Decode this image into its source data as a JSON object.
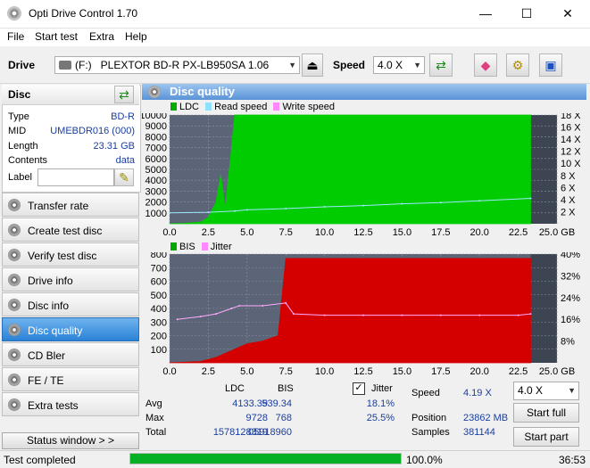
{
  "window": {
    "title": "Opti Drive Control 1.70",
    "minimize": "—",
    "maximize": "☐",
    "close": "✕"
  },
  "menu": [
    "File",
    "Start test",
    "Extra",
    "Help"
  ],
  "toolbar": {
    "drive_label": "Drive",
    "drive_letter": "(F:)",
    "drive_name": "PLEXTOR BD-R  PX-LB950SA 1.06",
    "speed_label": "Speed",
    "speed_value": "4.0 X"
  },
  "disc": {
    "header": "Disc",
    "fields": [
      {
        "key": "Type",
        "value": "BD-R"
      },
      {
        "key": "MID",
        "value": "UMEBDR016 (000)"
      },
      {
        "key": "Length",
        "value": "23.31 GB"
      },
      {
        "key": "Contents",
        "value": "data"
      },
      {
        "key": "Label",
        "value": ""
      }
    ]
  },
  "nav": [
    "Transfer rate",
    "Create test disc",
    "Verify test disc",
    "Drive info",
    "Disc info",
    "Disc quality",
    "CD Bler",
    "FE / TE",
    "Extra tests"
  ],
  "nav_active": "Disc quality",
  "status_window_button": "Status window > >",
  "panel_title": "Disc quality",
  "chart_data": [
    {
      "type": "area",
      "legend": [
        "LDC",
        "Read speed",
        "Write speed"
      ],
      "colors": {
        "LDC": "#00cc00",
        "Read speed": "#90e0ff",
        "Write speed": "#ff88ff"
      },
      "x_ticks": [
        "0.0",
        "2.5",
        "5.0",
        "7.5",
        "10.0",
        "12.5",
        "15.0",
        "17.5",
        "20.0",
        "22.5",
        "25.0 GB"
      ],
      "y_left_ticks": [
        "10000",
        "9000",
        "8000",
        "7000",
        "6000",
        "5000",
        "4000",
        "3000",
        "2000",
        "1000"
      ],
      "y_right_ticks": [
        "18 X",
        "16 X",
        "14 X",
        "12 X",
        "10 X",
        "8 X",
        "6 X",
        "4 X",
        "2 X"
      ],
      "xlim": [
        0,
        25
      ],
      "ylim": [
        0,
        10000
      ],
      "y2lim": [
        0,
        18
      ],
      "series": [
        {
          "name": "LDC",
          "x": [
            0,
            1,
            2,
            2.5,
            3,
            3.3,
            3.6,
            4.0,
            4.2,
            23.3
          ],
          "y": [
            0,
            50,
            150,
            600,
            2000,
            4500,
            1500,
            7000,
            10000,
            10000
          ]
        },
        {
          "name": "Read speed",
          "x": [
            0,
            2.5,
            4.2,
            5,
            7.5,
            10,
            12.5,
            15,
            17.5,
            20,
            23.3
          ],
          "y": [
            1.8,
            1.9,
            2.1,
            2.3,
            2.5,
            2.8,
            3.0,
            3.3,
            3.5,
            3.8,
            4.2
          ]
        }
      ]
    },
    {
      "type": "area",
      "legend": [
        "BIS",
        "Jitter"
      ],
      "colors": {
        "BIS": "#dd0000",
        "Jitter": "#ff88ff"
      },
      "x_ticks": [
        "0.0",
        "2.5",
        "5.0",
        "7.5",
        "10.0",
        "12.5",
        "15.0",
        "17.5",
        "20.0",
        "22.5",
        "25.0 GB"
      ],
      "y_left_ticks": [
        "800",
        "700",
        "600",
        "500",
        "400",
        "300",
        "200",
        "100"
      ],
      "y_right_ticks": [
        "40%",
        "32%",
        "24%",
        "16%",
        "8%"
      ],
      "xlim": [
        0,
        25
      ],
      "ylim": [
        0,
        800
      ],
      "y2lim": [
        0,
        40
      ],
      "series": [
        {
          "name": "BIS",
          "x": [
            0,
            2,
            3,
            4,
            5,
            6,
            7,
            7.5,
            23.3
          ],
          "y": [
            0,
            10,
            40,
            90,
            140,
            160,
            200,
            768,
            768
          ]
        },
        {
          "name": "Jitter",
          "x": [
            0.5,
            2,
            3,
            4,
            4.5,
            6,
            7.5,
            8,
            10,
            12.5,
            15,
            17.5,
            20,
            22.5,
            23.3
          ],
          "y": [
            16,
            17,
            18,
            20,
            21,
            21,
            22,
            18,
            17.5,
            17.5,
            17.5,
            17.5,
            17.5,
            17.5,
            18
          ]
        }
      ]
    }
  ],
  "stats": {
    "col_ldc": "LDC",
    "col_bis": "BIS",
    "jitter_label": "Jitter",
    "jitter_checked": true,
    "rows": [
      {
        "label": "Avg",
        "ldc": "4133.39",
        "bis": "539.34",
        "jitter": "18.1%"
      },
      {
        "label": "Max",
        "ldc": "9728",
        "bis": "768",
        "jitter": "25.5%"
      },
      {
        "label": "Total",
        "ldc": "1578128319",
        "bis": "05918960",
        "jitter": ""
      }
    ],
    "speed_label": "Speed",
    "speed_value": "4.19 X",
    "position_label": "Position",
    "position_value": "23862 MB",
    "samples_label": "Samples",
    "samples_value": "381144",
    "speed_select": "4.0 X",
    "start_full": "Start full",
    "start_part": "Start part"
  },
  "status": {
    "text": "Test completed",
    "progress": 100.0,
    "progress_text": "100.0%",
    "time": "36:53"
  }
}
